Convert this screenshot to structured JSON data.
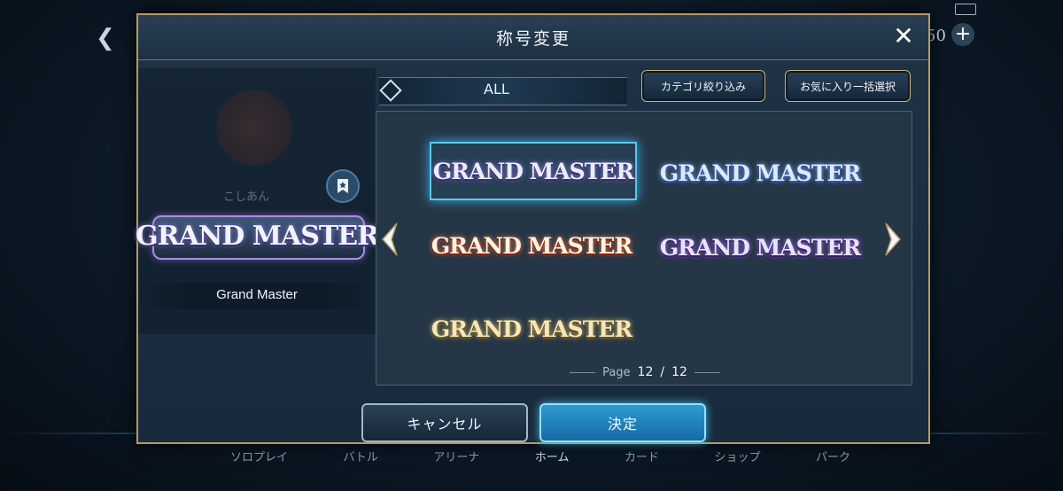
{
  "background": {
    "count_text": "50",
    "nav_items": [
      {
        "label": "ソロプレイ",
        "active": false
      },
      {
        "label": "バトル",
        "active": false
      },
      {
        "label": "アリーナ",
        "active": false
      },
      {
        "label": "ホーム",
        "active": true
      },
      {
        "label": "カード",
        "active": false
      },
      {
        "label": "ショップ",
        "active": false
      },
      {
        "label": "パーク",
        "active": false
      }
    ],
    "ghost_player_name": "こしあん"
  },
  "modal": {
    "title": "称号変更",
    "preview": {
      "badge_text": "GRAND MASTER",
      "selected_title_name": "Grand Master"
    },
    "category": {
      "label": "ALL",
      "filter_button": "カテゴリ絞り込み",
      "favorite_button": "お気に入り一括選択"
    },
    "grid": {
      "items": [
        {
          "text": "GRAND MASTER",
          "style": "purple-teal",
          "selected": true
        },
        {
          "text": "GRAND MASTER",
          "style": "blue-gold",
          "selected": false
        },
        {
          "text": "GRAND MASTER",
          "style": "red-gold",
          "selected": false
        },
        {
          "text": "GRAND MASTER",
          "style": "violet-dark",
          "selected": false
        },
        {
          "text": "GRAND MASTER",
          "style": "gold",
          "selected": false
        }
      ],
      "page_label": "Page",
      "page_current": "12",
      "page_separator": "/",
      "page_total": "12"
    },
    "cancel_button": "キャンセル",
    "confirm_button": "決定"
  },
  "colors": {
    "accent_gold": "#b39a66",
    "selection_cyan": "#56c8f2",
    "confirm_blue": "#2f9ad2"
  }
}
